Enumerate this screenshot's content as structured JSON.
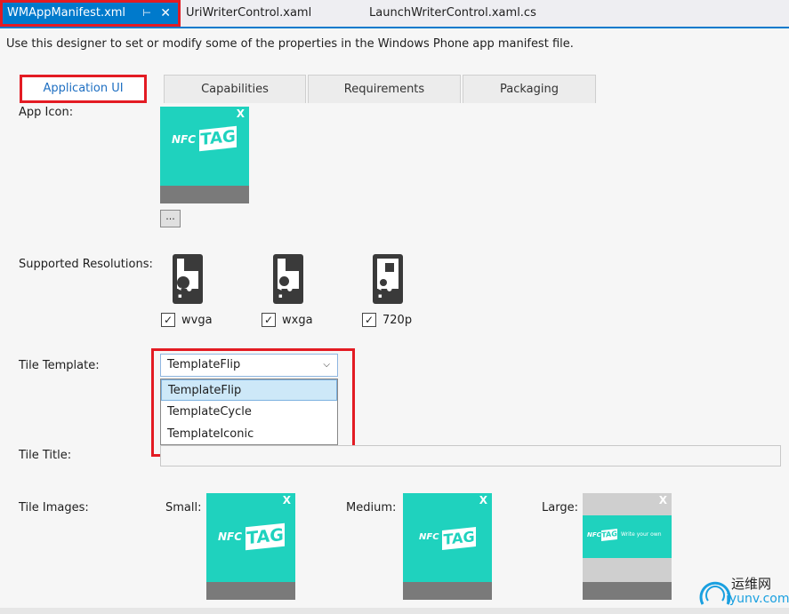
{
  "doc_tabs": {
    "active": "WMAppManifest.xml",
    "pin_glyph": "⊢",
    "close_glyph": "✕",
    "tab2": "UriWriterControl.xaml",
    "tab3": "LaunchWriterControl.xaml.cs"
  },
  "description": "Use this designer to set or modify some of the properties in the Windows Phone app manifest file.",
  "tabs": [
    "Application UI",
    "Capabilities",
    "Requirements",
    "Packaging"
  ],
  "app_icon": {
    "label": "App Icon:",
    "nfc": "NFC",
    "tag": "TAG",
    "remove": "X",
    "browse": "..."
  },
  "resolutions": {
    "label": "Supported Resolutions:",
    "items": [
      {
        "name": "wvga",
        "checked": true
      },
      {
        "name": "wxga",
        "checked": true
      },
      {
        "name": "720p",
        "checked": true
      }
    ],
    "check_glyph": "✓"
  },
  "tile_template": {
    "label": "Tile Template:",
    "selected": "TemplateFlip",
    "options": [
      "TemplateFlip",
      "TemplateCycle",
      "TemplateIconic"
    ]
  },
  "tile_title": {
    "label": "Tile Title:",
    "value": ""
  },
  "tile_images": {
    "label": "Tile Images:",
    "small": "Small:",
    "medium": "Medium:",
    "large": "Large:",
    "large_caption": "Write your own"
  },
  "watermark": {
    "cn": "运维网",
    "url": "iyunv.com"
  },
  "colors": {
    "accent": "#007acc",
    "highlight_red": "#e31b23",
    "tile": "#1fd2be"
  }
}
